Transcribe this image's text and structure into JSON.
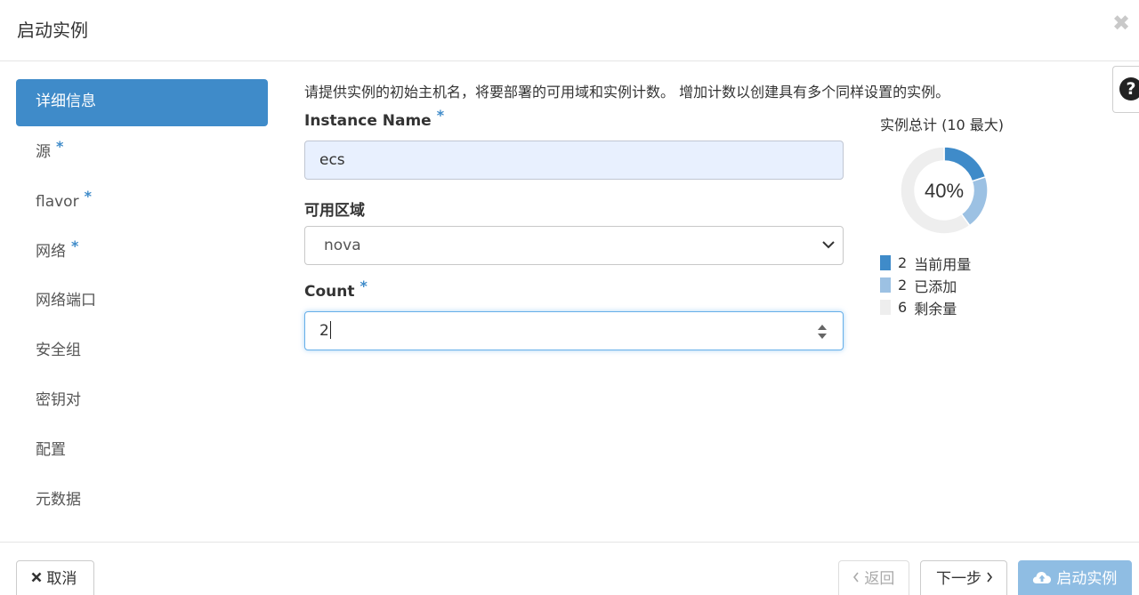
{
  "modal": {
    "title": "启动实例",
    "close_glyph": "✖"
  },
  "help": {
    "glyph": "?"
  },
  "sidebar": {
    "items": [
      {
        "label": "详细信息",
        "active": true,
        "required": false
      },
      {
        "label": "源",
        "active": false,
        "required": true
      },
      {
        "label": "flavor",
        "active": false,
        "required": true
      },
      {
        "label": "网络",
        "active": false,
        "required": true
      },
      {
        "label": "网络端口",
        "active": false,
        "required": false
      },
      {
        "label": "安全组",
        "active": false,
        "required": false
      },
      {
        "label": "密钥对",
        "active": false,
        "required": false
      },
      {
        "label": "配置",
        "active": false,
        "required": false
      },
      {
        "label": "元数据",
        "active": false,
        "required": false
      }
    ],
    "required_mark": "*"
  },
  "form": {
    "description": "请提供实例的初始主机名，将要部署的可用域和实例计数。 增加计数以创建具有多个同样设置的实例。",
    "instance_name": {
      "label": "Instance Name",
      "value": "ecs",
      "required_mark": "*"
    },
    "availability_zone": {
      "label": "可用区域",
      "value": "nova"
    },
    "count": {
      "label": "Count",
      "value": "2",
      "required_mark": "*"
    }
  },
  "quota": {
    "title": "实例总计 (10 最大)",
    "percent_label": "40%"
  },
  "chart_data": {
    "type": "pie",
    "title": "实例总计 (10 最大)",
    "total": 10,
    "center_label": "40%",
    "slices": [
      {
        "label": "当前用量",
        "value": 2,
        "color": "#3f8bc9"
      },
      {
        "label": "已添加",
        "value": 2,
        "color": "#9cc1e3"
      },
      {
        "label": "剩余量",
        "value": 6,
        "color": "#eeeeee"
      }
    ]
  },
  "footer": {
    "cancel_label": "取消",
    "back_label": "返回",
    "next_label": "下一步",
    "launch_label": "启动实例"
  },
  "icons": {
    "close": "close-icon",
    "help": "question-circle-icon",
    "cancel": "x-icon",
    "back": "chevron-left-icon",
    "next": "chevron-right-icon",
    "launch": "cloud-upload-icon",
    "select": "chevron-down-icon",
    "spinner": "spinner-arrows-icon"
  }
}
